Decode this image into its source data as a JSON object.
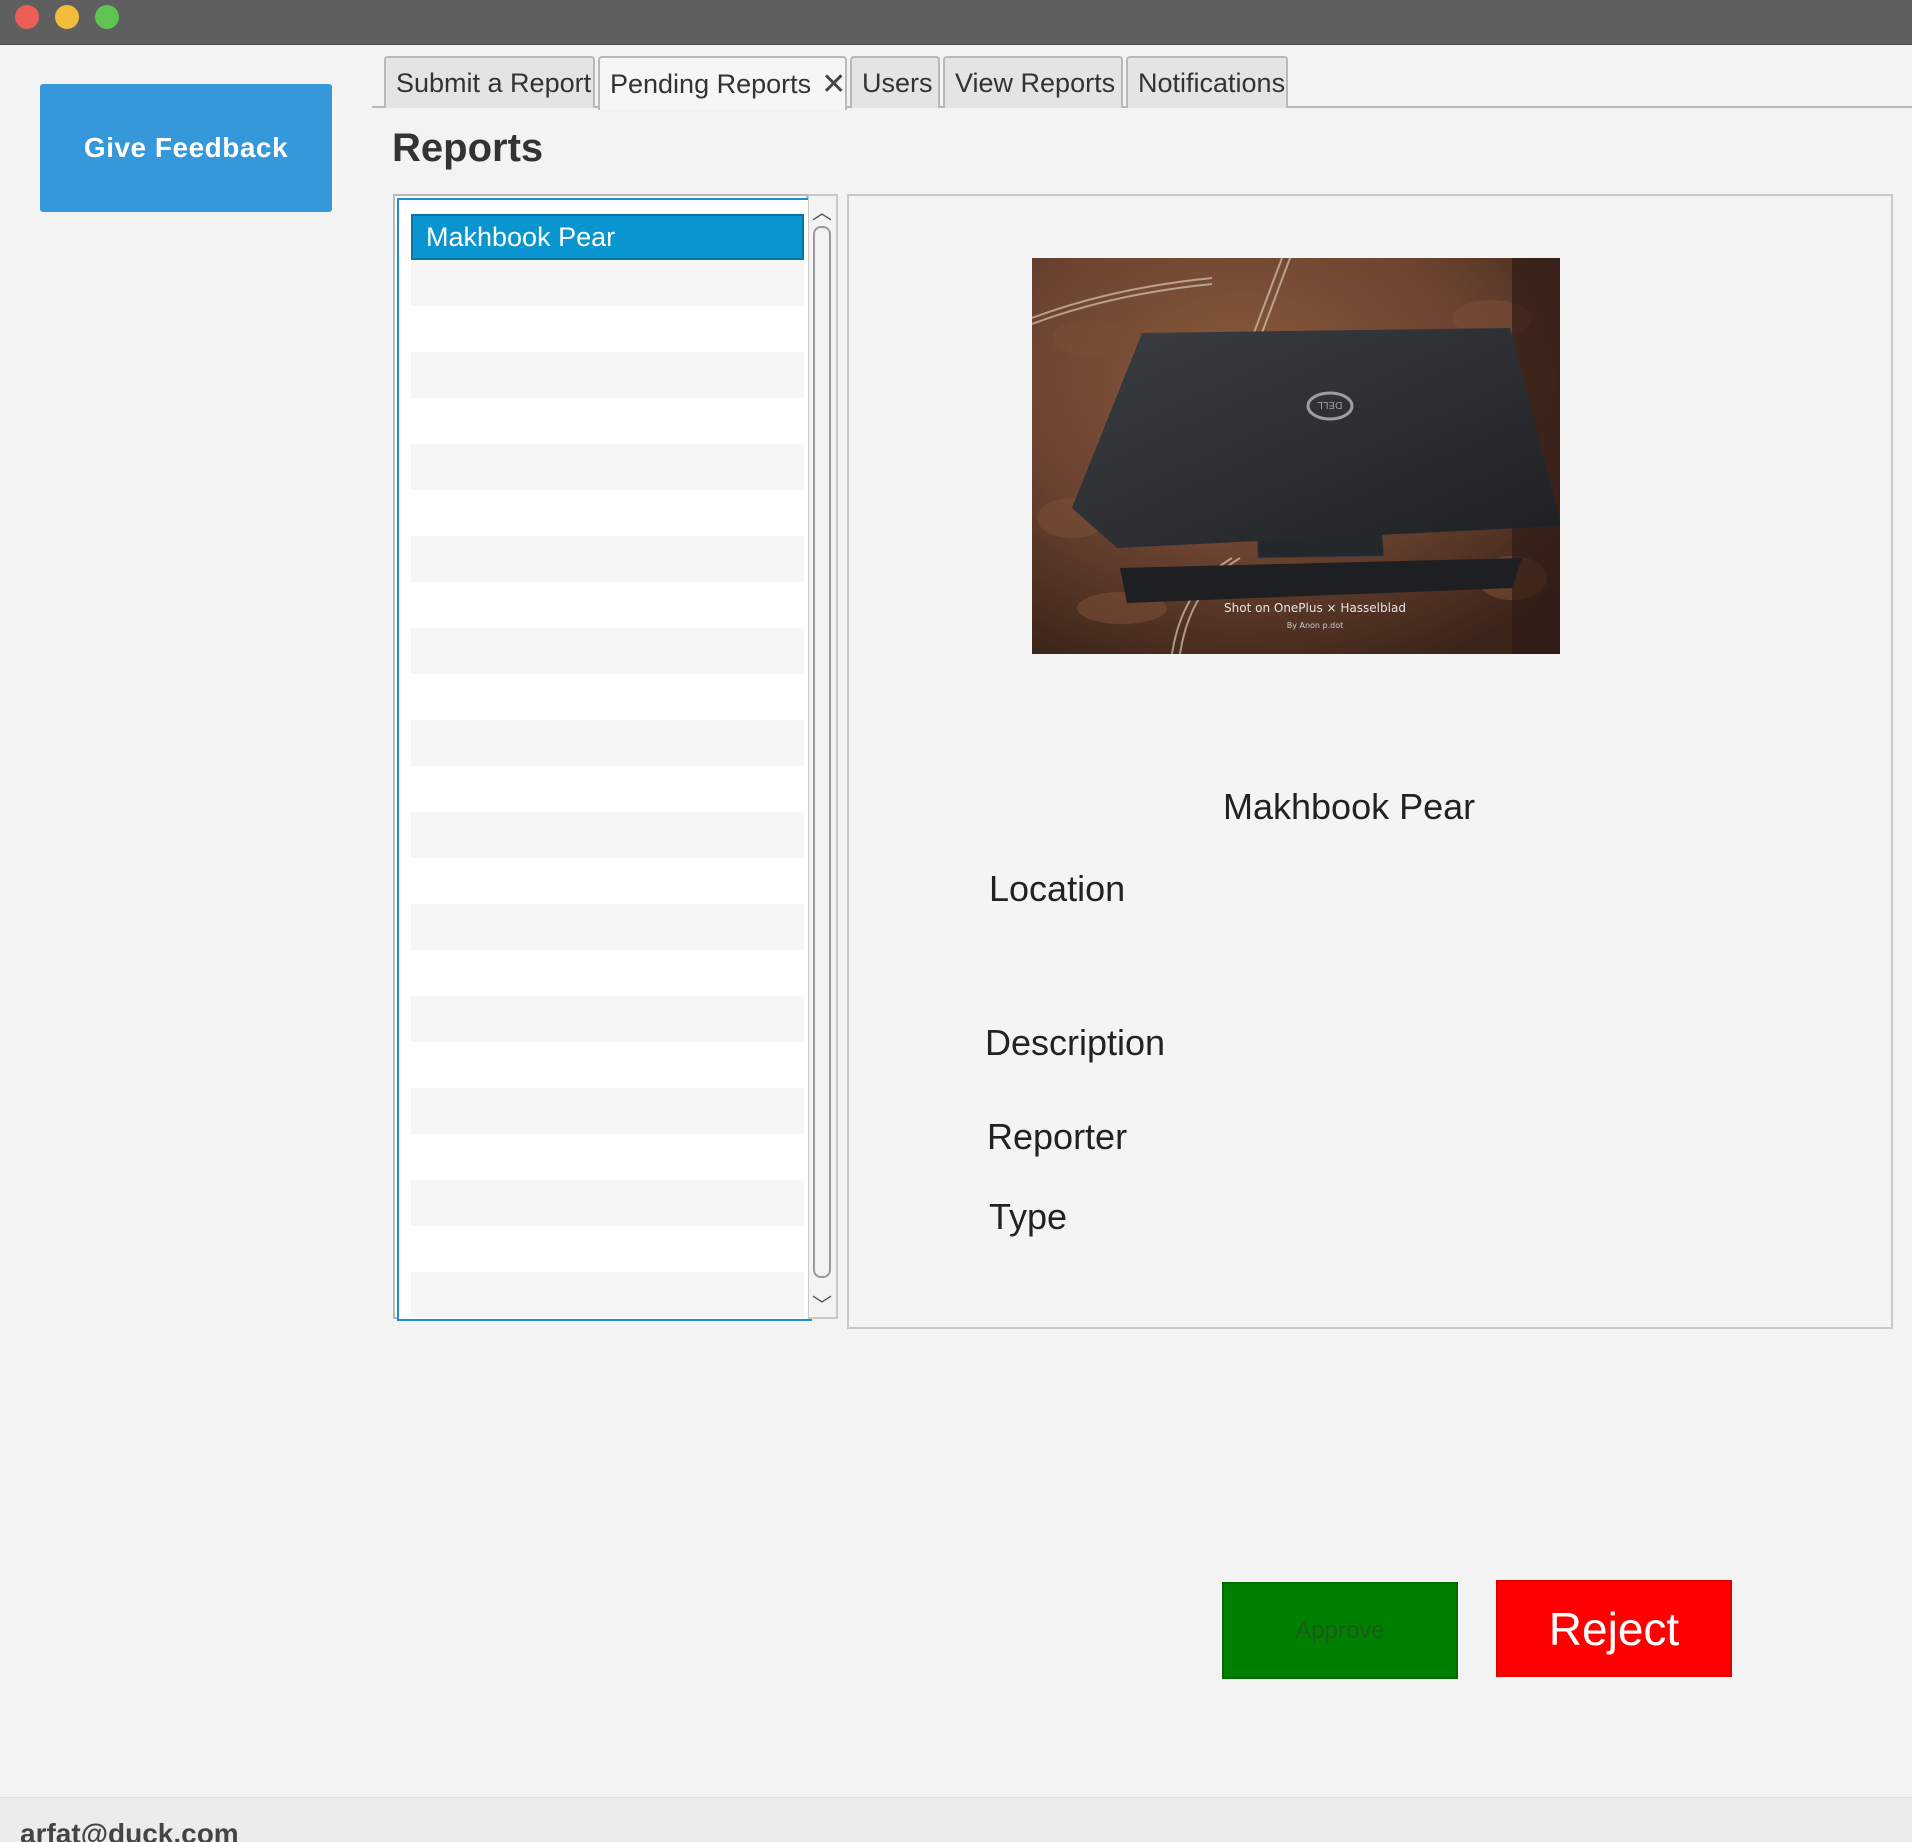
{
  "window": {
    "controls": [
      "close",
      "minimize",
      "zoom"
    ]
  },
  "sidebar": {
    "feedback_label": "Give Feedback"
  },
  "tabs": [
    {
      "label": "Submit a Report",
      "active": false
    },
    {
      "label": "Pending Reports",
      "active": true,
      "closable": true,
      "close_glyph": "✕"
    },
    {
      "label": "Users",
      "active": false
    },
    {
      "label": "View Reports",
      "active": false
    },
    {
      "label": "Notifications",
      "active": false
    }
  ],
  "page": {
    "title": "Reports"
  },
  "reports_list": {
    "items": [
      "Makhbook Pear"
    ],
    "selected_index": 0
  },
  "detail": {
    "image_caption": "Shot on OnePlus × Hasselblad",
    "image_subcaption": "By Anon p.dot",
    "name": "Makhbook Pear",
    "location_label": "Location",
    "description_label": "Description",
    "reporter_label": "Reporter",
    "type_label": "Type"
  },
  "actions": {
    "approve_label": "Approve",
    "reject_label": "Reject"
  },
  "status": {
    "user_email": "arfat@duck.com"
  },
  "colors": {
    "feedback_button": "#3498db",
    "selection": "#0895d0",
    "approve": "#008000",
    "reject": "#ff0000"
  }
}
